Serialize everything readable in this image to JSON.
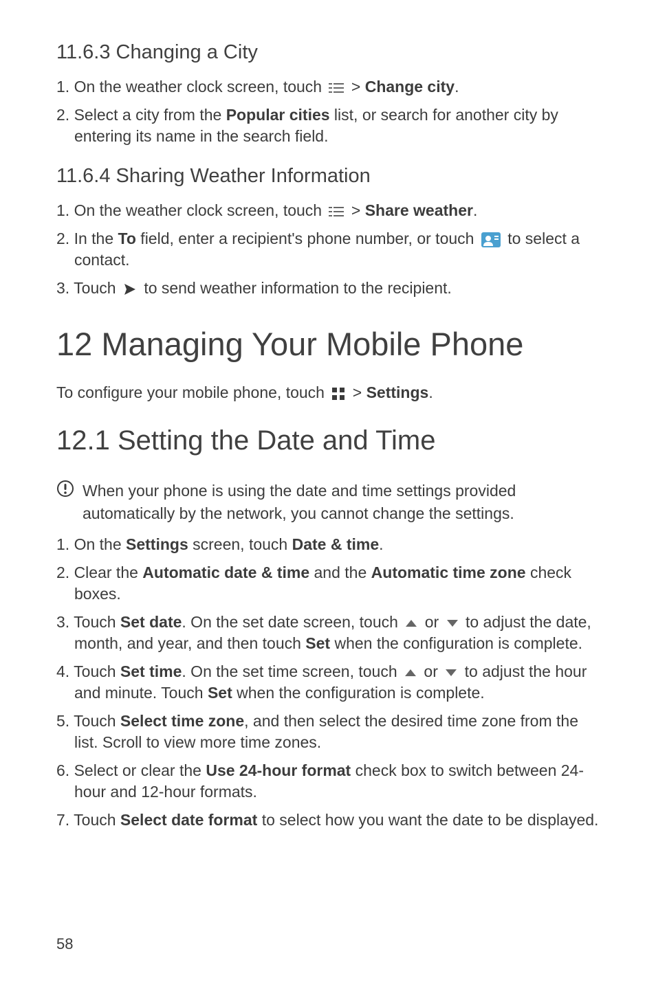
{
  "section_11_6_3": {
    "heading": "11.6.3  Changing a City",
    "step1_a": "1. On the weather clock screen, touch ",
    "step1_b": " > ",
    "step1_bold": "Change city",
    "step1_c": ".",
    "step2_a": "2. Select a city from the ",
    "step2_bold": "Popular cities",
    "step2_b": " list, or search for another city by entering its name in the search field."
  },
  "section_11_6_4": {
    "heading": "11.6.4  Sharing Weather Information",
    "step1_a": "1. On the weather clock screen, touch ",
    "step1_b": " > ",
    "step1_bold": "Share weather",
    "step1_c": ".",
    "step2_a": "2. In the ",
    "step2_bold": "To",
    "step2_b": " field, enter a recipient's phone number, or touch ",
    "step2_c": " to select a contact.",
    "step3_a": "3. Touch ",
    "step3_b": " to send weather information to the recipient."
  },
  "chapter_12": {
    "heading": "12  Managing Your Mobile Phone",
    "intro_a": "To configure your mobile phone, touch ",
    "intro_b": " > ",
    "intro_bold": "Settings",
    "intro_c": "."
  },
  "section_12_1": {
    "heading": "12.1  Setting the Date and Time",
    "note": "When your phone is using the date and time settings provided automatically by the network, you cannot change the settings.",
    "step1_a": "1. On the ",
    "step1_bold1": "Settings",
    "step1_b": " screen, touch ",
    "step1_bold2": "Date & time",
    "step1_c": ".",
    "step2_a": "2. Clear the ",
    "step2_bold1": "Automatic date & time",
    "step2_b": " and the ",
    "step2_bold2": "Automatic time zone",
    "step2_c": " check boxes.",
    "step3_a": "3. Touch ",
    "step3_bold1": "Set date",
    "step3_b": ". On the set date screen, touch ",
    "step3_mid": " or ",
    "step3_c": " to adjust the date, month, and year, and then touch ",
    "step3_bold2": "Set",
    "step3_d": " when the configuration is complete.",
    "step4_a": "4. Touch ",
    "step4_bold1": "Set time",
    "step4_b": ". On the set time screen, touch ",
    "step4_mid": " or ",
    "step4_c": " to adjust the hour and minute. Touch ",
    "step4_bold2": "Set",
    "step4_d": " when the configuration is complete.",
    "step5_a": "5. Touch ",
    "step5_bold": "Select time zone",
    "step5_b": ", and then select the desired time zone from the list. Scroll to view more time zones.",
    "step6_a": "6. Select or clear the ",
    "step6_bold": "Use 24-hour format",
    "step6_b": " check box to switch between 24-hour and 12-hour formats.",
    "step7_a": "7. Touch ",
    "step7_bold": "Select date format",
    "step7_b": " to select how you want the date to be displayed."
  },
  "page_number": "58"
}
